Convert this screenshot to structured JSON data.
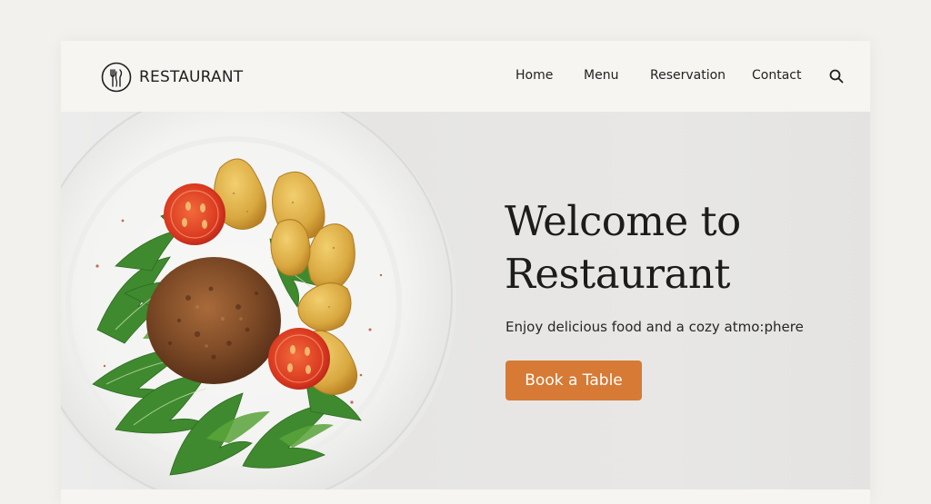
{
  "brand": {
    "name": "RESTAURANT",
    "logo_icon": "cutlery-bouquet-icon"
  },
  "nav": {
    "items": [
      {
        "label": "Home"
      },
      {
        "label": "Menu"
      },
      {
        "label": "Reservation"
      },
      {
        "label": "Contact"
      }
    ],
    "search_icon": "search-icon"
  },
  "hero": {
    "title_line1": "Welcome to",
    "title_line2": "Restaurant",
    "subtitle": "Enjoy delicious food and a cozy atmo:phere",
    "cta_label": "Book a Table",
    "image": "plate-with-patty-potatoes-tomatoes-arugula"
  },
  "colors": {
    "accent": "#d67a35",
    "page_bg": "#f3f1ee",
    "card_bg": "#f7f5f2",
    "text": "#1c1c1c"
  }
}
